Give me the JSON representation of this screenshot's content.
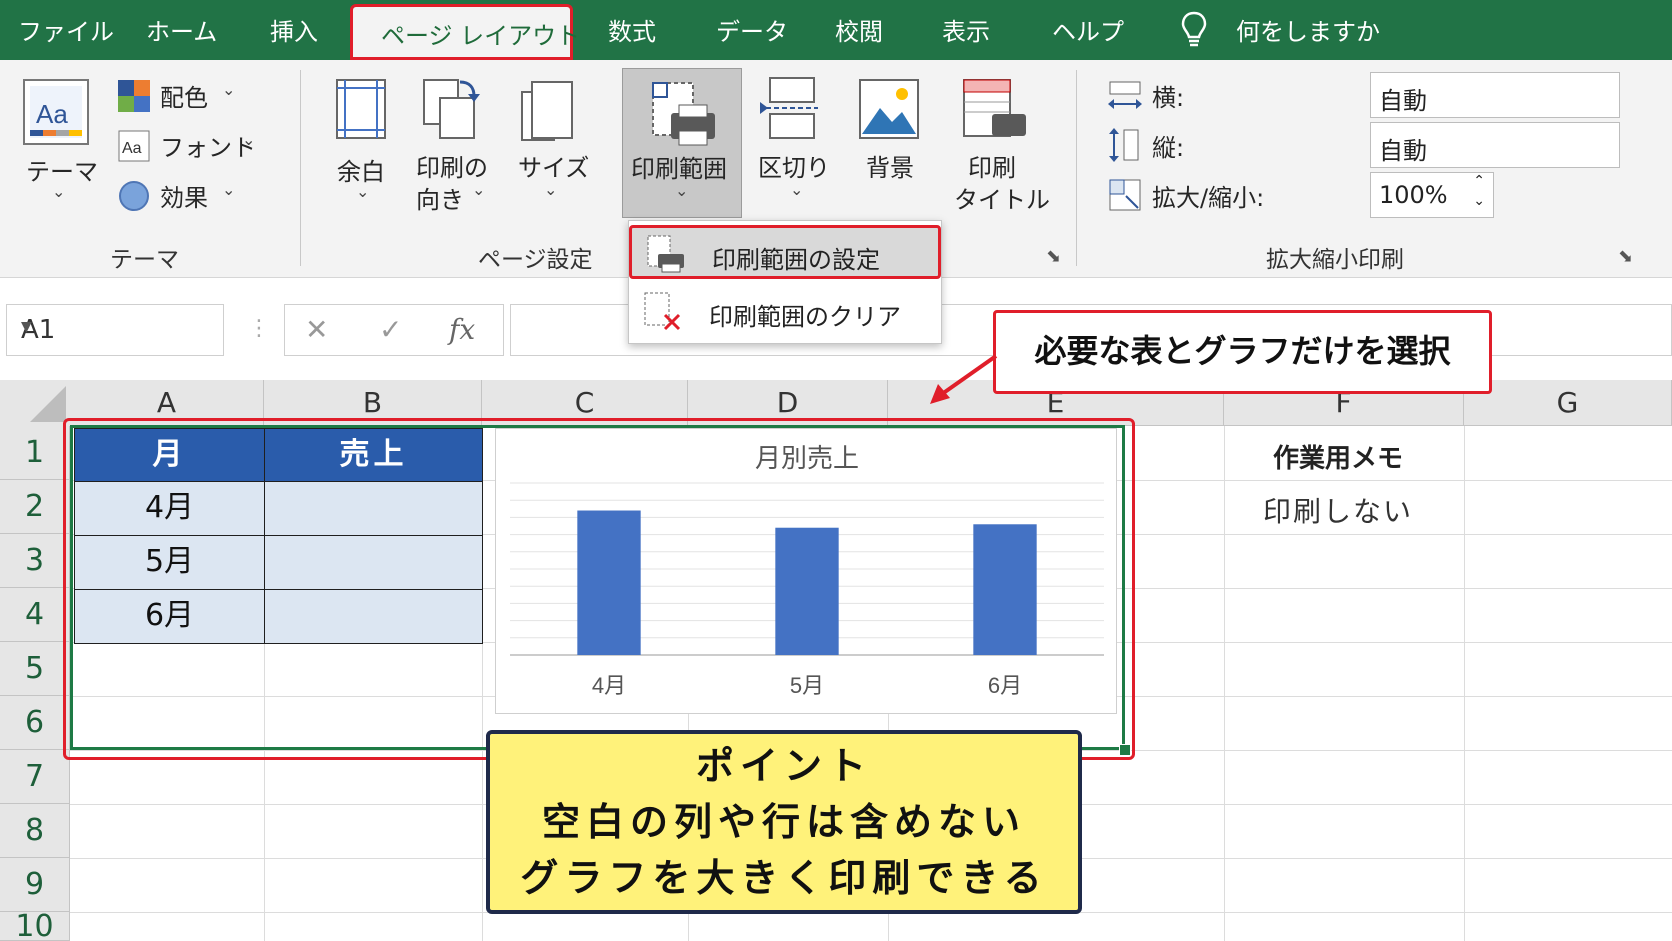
{
  "menu": {
    "tabs": [
      "ファイル",
      "ホーム",
      "挿入",
      "ページ レイアウト",
      "数式",
      "データ",
      "校閲",
      "表示",
      "ヘルプ"
    ],
    "tell_me": "何をしますか",
    "active_tab": "ページ レイアウト"
  },
  "ribbon": {
    "theme_group": {
      "themes_label": "テーマ",
      "colors_label": "配色",
      "fonts_label": "フォント",
      "effects_label": "効果",
      "group_label": "テーマ"
    },
    "page_setup_group": {
      "margins_label": "余白",
      "orientation_label1": "印刷の",
      "orientation_label2": "向き",
      "size_label": "サイズ",
      "print_area_label": "印刷範囲",
      "breaks_label": "区切り",
      "background_label": "背景",
      "print_titles_label1": "印刷",
      "print_titles_label2": "タイトル",
      "group_label": "ページ設定"
    },
    "scale_group": {
      "width_label": "横:",
      "width_value": "自動",
      "height_label": "縦:",
      "height_value": "自動",
      "scale_label": "拡大/縮小:",
      "scale_value": "100%",
      "group_label": "拡大縮小印刷"
    }
  },
  "dropdown": {
    "set_print_area": "印刷範囲の設定",
    "clear_print_area": "印刷範囲のクリア"
  },
  "formula_bar": {
    "name_box": "A1",
    "fx": "fx",
    "cancel": "✕",
    "enter": "✓"
  },
  "sheet": {
    "columns": [
      "A",
      "B",
      "C",
      "D",
      "E",
      "F",
      "G"
    ],
    "rows": [
      "1",
      "2",
      "3",
      "4",
      "5",
      "6",
      "7",
      "8",
      "9",
      "10"
    ],
    "table": {
      "header": [
        "月",
        "売上"
      ],
      "months": [
        "4月",
        "5月",
        "6月"
      ]
    },
    "memo_header": "作業用メモ",
    "memo_value": "印刷しない"
  },
  "chart_data": {
    "type": "bar",
    "title": "月別売上",
    "categories": [
      "4月",
      "5月",
      "6月"
    ],
    "values": [
      84,
      74,
      76
    ],
    "ylim": [
      0,
      100
    ],
    "grid": true,
    "color": "#4472c4"
  },
  "callouts": {
    "top": "必要な表とグラフだけを選択",
    "bottom_lines": [
      "ポイント",
      "空白の列や行は含めない",
      "グラフを大きく印刷できる"
    ]
  },
  "colors": {
    "excel_green": "#217346",
    "highlight_red": "#e01e2a",
    "table_header_blue": "#2a5cab",
    "callout_yellow": "#fff27a"
  }
}
